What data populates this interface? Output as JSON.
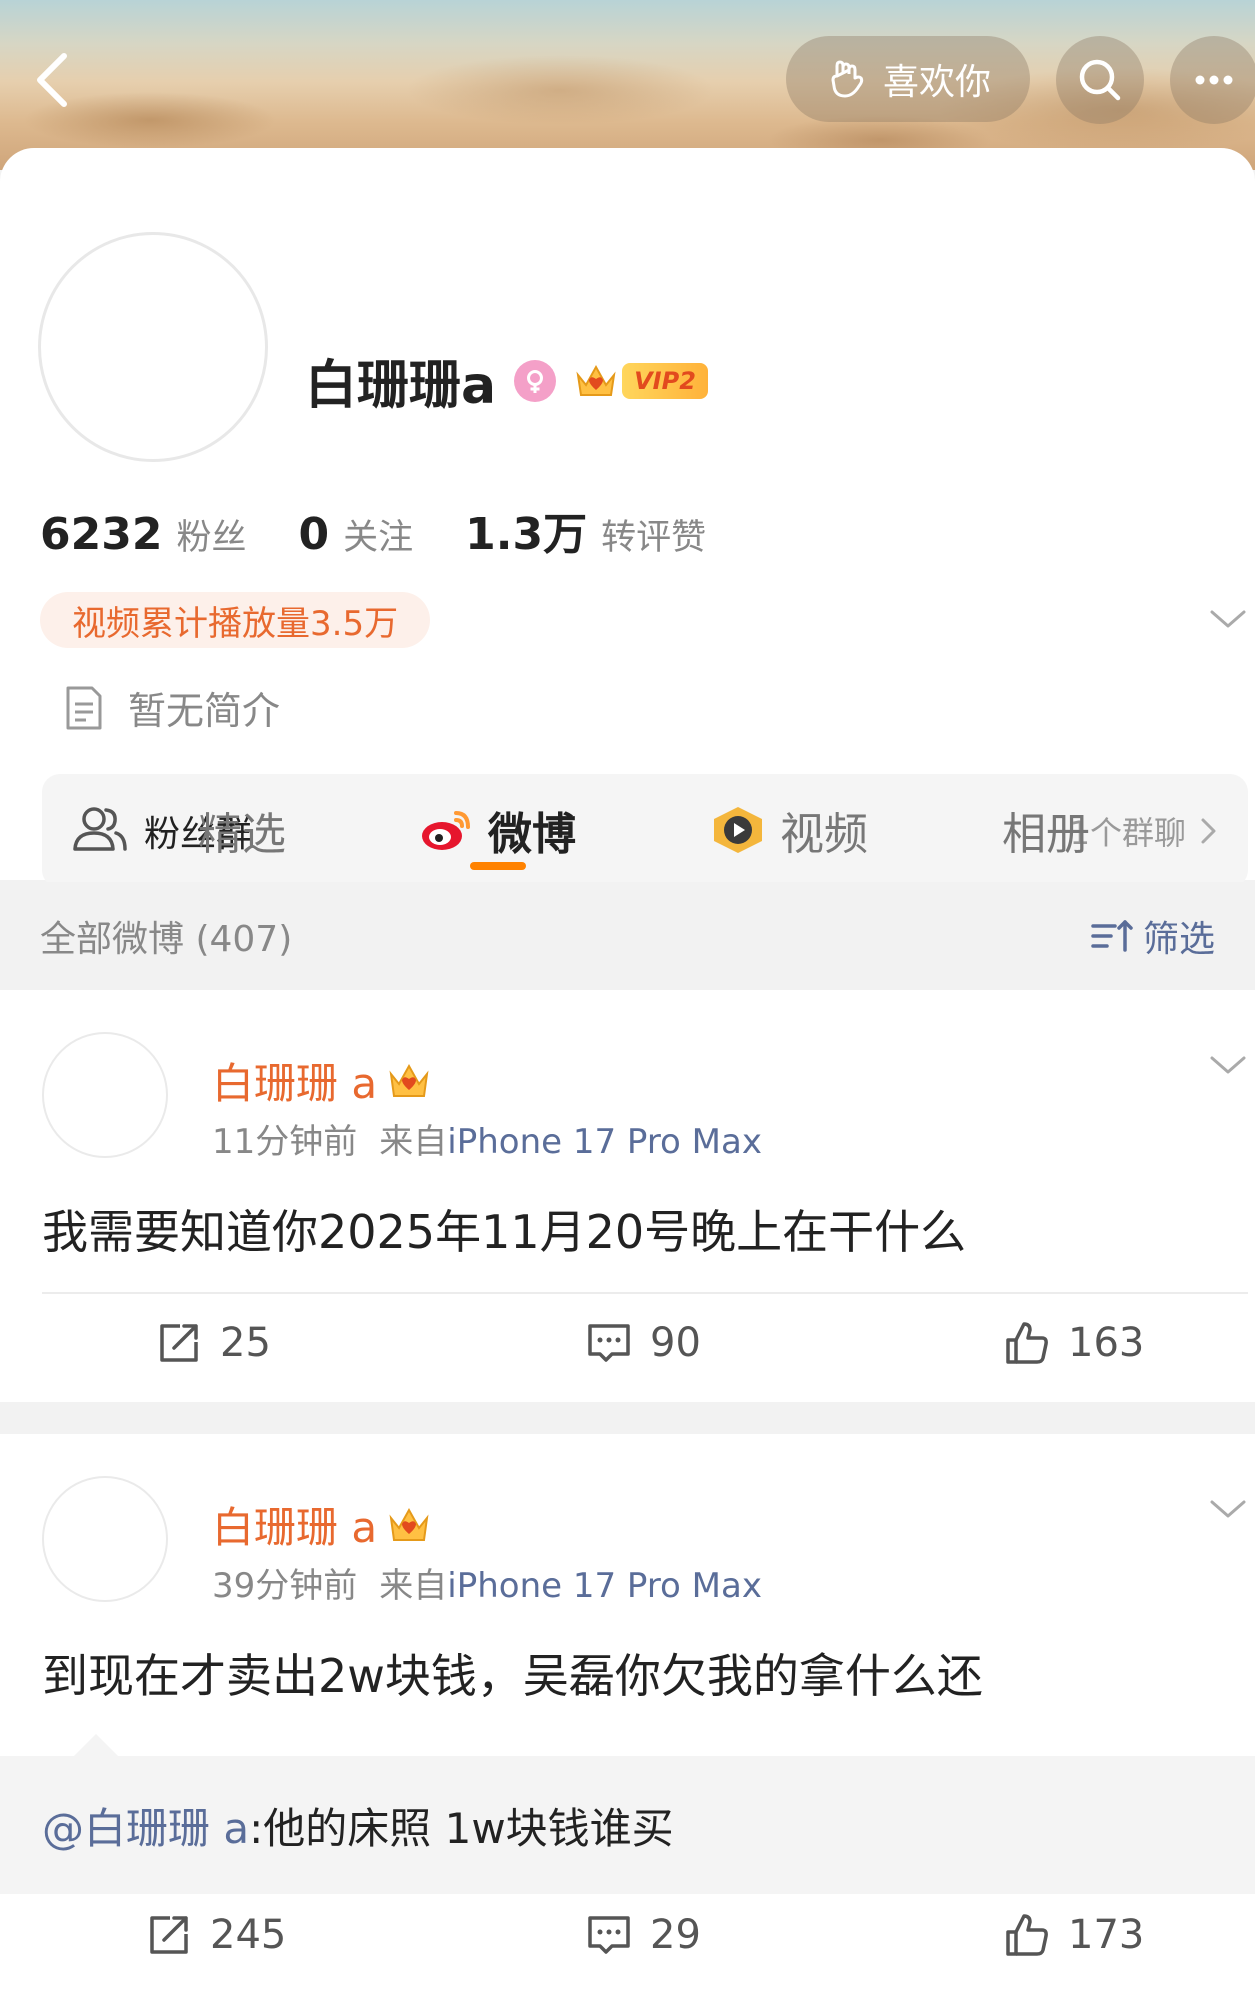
{
  "header": {
    "like_button_label": "喜欢你"
  },
  "profile": {
    "name": "白珊珊a",
    "vip_label": "VIP2",
    "stats": [
      {
        "value": "6232",
        "label": "粉丝"
      },
      {
        "value": "0",
        "label": "关注"
      },
      {
        "value": "1.3万",
        "label": "转评赞"
      }
    ],
    "video_plays": "视频累计播放量3.5万",
    "bio": "暂无简介",
    "fan_group": {
      "title": "粉丝群",
      "count": "1个群聊"
    }
  },
  "tabs": [
    {
      "label": "精选",
      "active": false
    },
    {
      "label": "微博",
      "active": true
    },
    {
      "label": "视频",
      "active": false
    },
    {
      "label": "相册",
      "active": false
    }
  ],
  "filter": {
    "all_posts": "全部微博 (407)",
    "filter_label": "筛选"
  },
  "posts": [
    {
      "author": "白珊珊 a",
      "time": "11分钟前",
      "source": "来自",
      "device": "iPhone 17 Pro Max",
      "text": "我需要知道你2025年11月20号晚上在干什么",
      "reposts": "25",
      "comments": "90",
      "likes": "163"
    },
    {
      "author": "白珊珊 a",
      "time": "39分钟前",
      "source": "来自",
      "device": "iPhone 17 Pro Max",
      "text": "到现在才卖出2w块钱，吴磊你欠我的拿什么还",
      "repost_mention": "@白珊珊 a",
      "repost_text": ":他的床照 1w块钱谁买",
      "reposts": "245",
      "comments": "29",
      "likes": "173"
    }
  ],
  "colors": {
    "accent_orange": "#ff8200",
    "author_orange": "#e8692f",
    "link_blue": "#5a6d99",
    "vip_gold": "#ffc043"
  }
}
